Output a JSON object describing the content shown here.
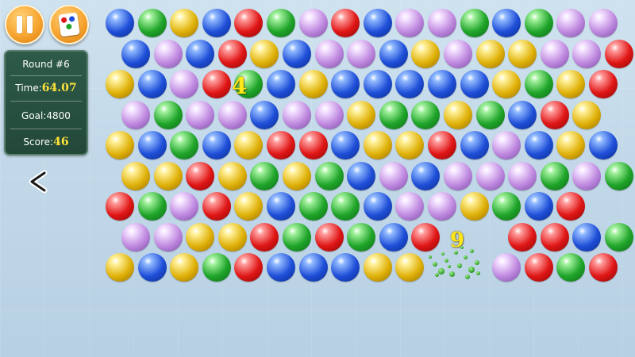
{
  "hud": {
    "pause_icon": "pause-icon",
    "theme_icon": "card-theme-icon",
    "round_label": "Round #6",
    "time_label": "Time:",
    "time_value": "64.07",
    "goal_label": "Goal:",
    "goal_value": "4800",
    "score_label": "Score:",
    "score_value": "46",
    "back_icon": "chevron-left-icon"
  },
  "popups": [
    {
      "text": "4"
    },
    {
      "text": "9"
    }
  ],
  "colors": {
    "B": [
      "#8fb8ff",
      "#1f4fd8",
      "#0a2a8a"
    ],
    "G": [
      "#9ff09a",
      "#20a52a",
      "#0c6a16"
    ],
    "Y": [
      "#fff19a",
      "#e0b20a",
      "#9a6e00"
    ],
    "R": [
      "#ff9a9a",
      "#e01616",
      "#8a0606"
    ],
    "P": [
      "#f3e0ff",
      "#c08ae0",
      "#7a4aa6"
    ]
  },
  "board": {
    "rows": [
      "BGYBRGPRBPPGBGPP",
      "BPBRYBPPBYPYYPPR",
      "YBPRGBYBBBBBYGYR",
      "PGPPBPPYGGYGBRY",
      "YBGBYRRBYYRBPBYB",
      "YYRYGYGBPBPPPGPG",
      "RGPRYBGGBPPYGBR",
      "PPYYRGRGBR..RRBGB",
      "YBYGRBBBYY..PRGR"
    ]
  }
}
